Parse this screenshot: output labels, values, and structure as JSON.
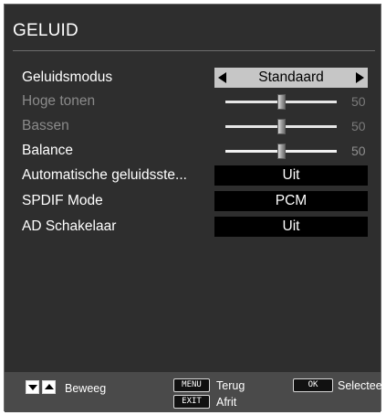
{
  "menu": {
    "title": "GELUID",
    "rows": {
      "sound_mode": {
        "label": "Geluidsmodus",
        "value": "Standaard"
      },
      "treble": {
        "label": "Hoge tonen",
        "value": "50",
        "level": 0.5
      },
      "bass": {
        "label": "Bassen",
        "value": "50",
        "level": 0.5
      },
      "balance": {
        "label": "Balance",
        "value": "50",
        "level": 0.5
      },
      "auto_volume": {
        "label": "Automatische geluidsste...",
        "value": "Uit"
      },
      "spdif": {
        "label": "SPDIF Mode",
        "value": "PCM"
      },
      "ad_switch": {
        "label": "AD Schakelaar",
        "value": "Uit"
      }
    }
  },
  "footer": {
    "move_label": "Beweeg",
    "menu_key": "MENU",
    "back_label": "Terug",
    "exit_key": "EXIT",
    "exit_label": "Afrit",
    "ok_key": "OK",
    "select_label": "Selecteer"
  },
  "colors": {
    "panel": "#2e2e2e",
    "selected_option_bg": "#c6c6c6",
    "option_bg": "#000000",
    "disabled_text": "#8a8a8a"
  }
}
